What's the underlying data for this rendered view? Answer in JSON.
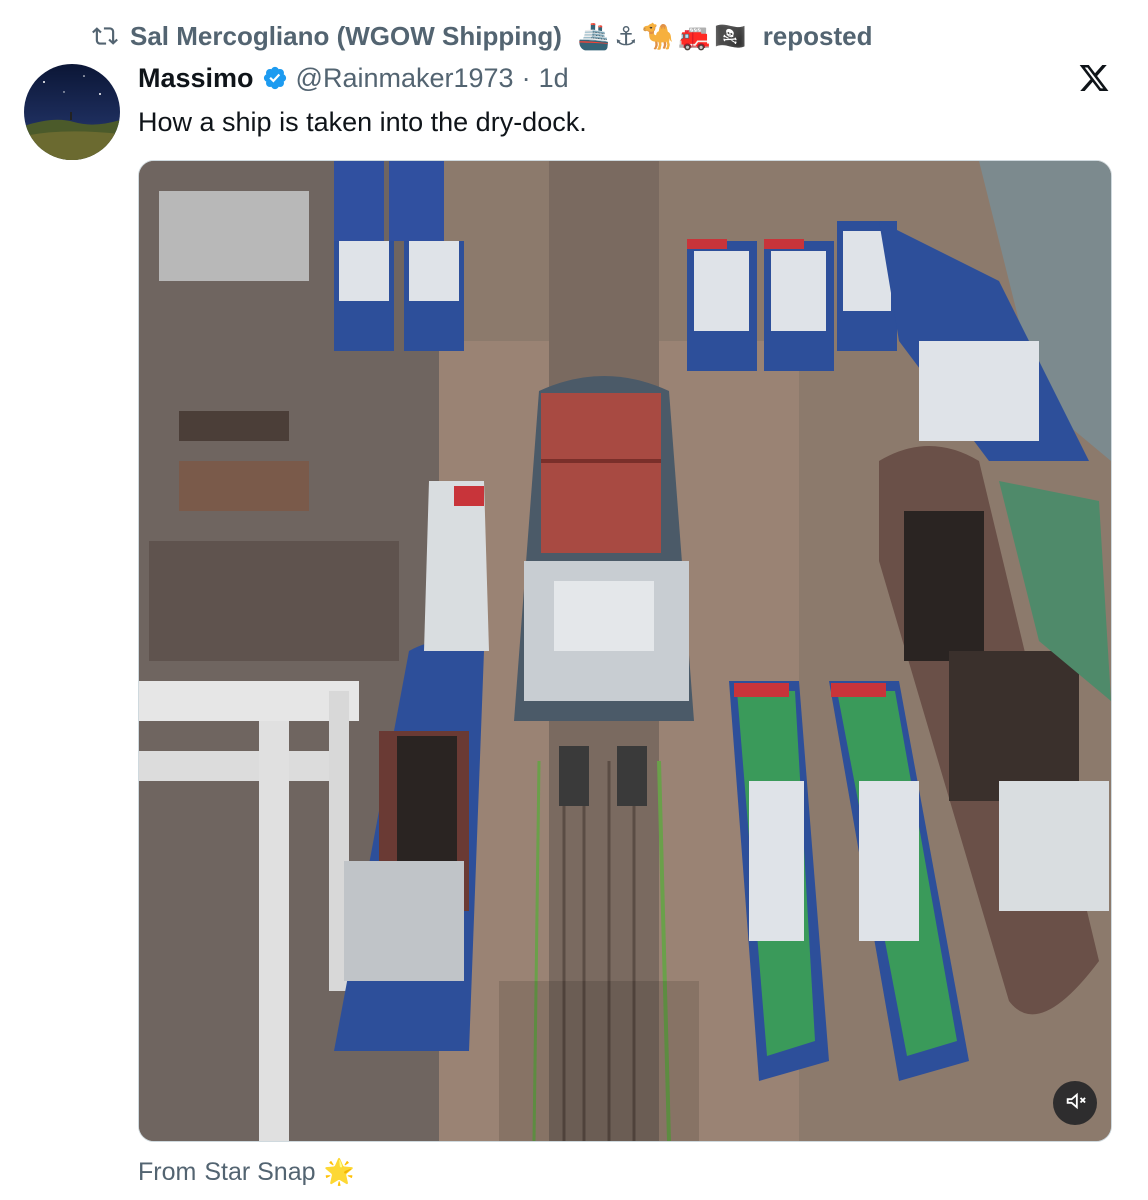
{
  "repost": {
    "icon": "repost-icon",
    "user": "Sal Mercogliano (WGOW Shipping)",
    "emojis": [
      "🚢",
      "⚓",
      "🐪",
      "🚒",
      "🏴‍☠️"
    ],
    "action": "reposted"
  },
  "tweet": {
    "display_name": "Massimo",
    "handle": "@Rainmaker1973",
    "separator": "·",
    "time": "1d",
    "text": "How a ship is taken into the dry-dock.",
    "media": {
      "type": "video",
      "description_icon": "video-thumbnail",
      "mute_icon": "volume-muted-icon"
    },
    "footer_prefix": "From",
    "footer_source": "Star Snap",
    "footer_emoji": "🌟"
  },
  "colors": {
    "accent": "#1d9bf0",
    "secondary_text": "#536471",
    "primary_text": "#0f1419"
  }
}
